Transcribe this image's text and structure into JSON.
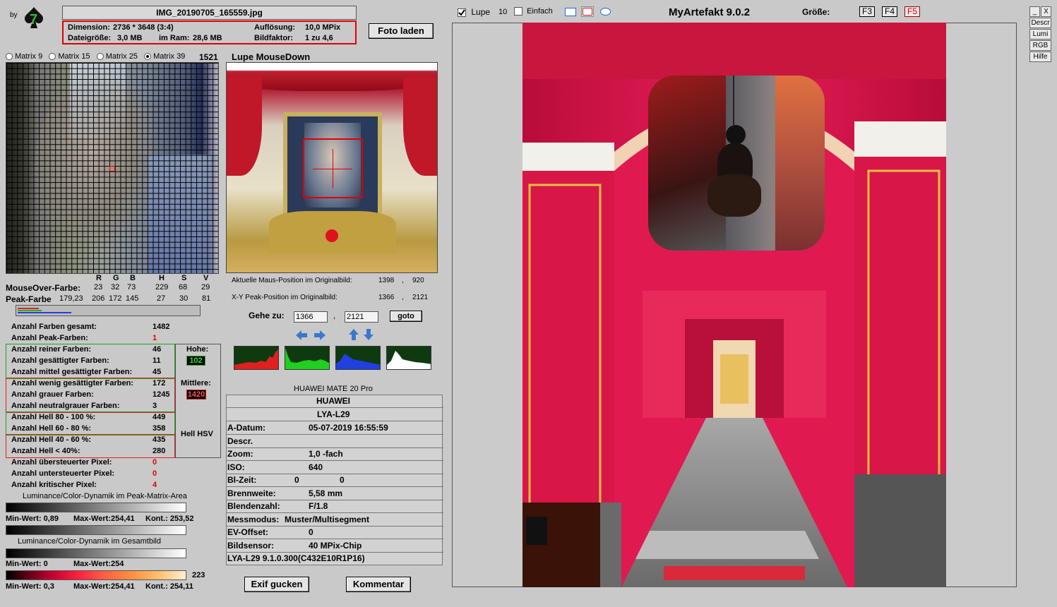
{
  "app": {
    "by_label": "by",
    "title": "MyArtefakt 9.0.2"
  },
  "file": {
    "name": "IMG_20190705_165559.jpg"
  },
  "info": {
    "dimension_label": "Dimension:",
    "dimension_value": "2736 * 3648 (3:4)",
    "aufloesung_label": "Auflösung:",
    "aufloesung_value": "10,0 MPix",
    "dateigroesse_label": "Dateigröße:",
    "dateigroesse_value": "3,0 MB",
    "imram_label": "im Ram:",
    "imram_value": "28,6 MB",
    "bildfaktor_label": "Bildfaktor:",
    "bildfaktor_value": "1 zu 4,6"
  },
  "buttons": {
    "foto_laden": "Foto laden",
    "exif": "Exif gucken",
    "kommentar": "Kommentar",
    "goto": "goto"
  },
  "toolbar": {
    "lupe_label": "Lupe",
    "lupe_checked": true,
    "lupe_value": "10",
    "einfach_label": "Einfach",
    "einfach_checked": false,
    "groesse_label": "Größe:",
    "keys": [
      "F3",
      "F4",
      "F5"
    ],
    "active_key": "F5"
  },
  "side": {
    "min": "_",
    "close": "X",
    "items": [
      "Descr",
      "Lumi",
      "RGB",
      "Hilfe"
    ]
  },
  "matrix": {
    "options": [
      "Matrix 9",
      "Matrix 15",
      "Matrix 25",
      "Matrix 39"
    ],
    "selected": 3,
    "count": "1521"
  },
  "lupe": {
    "title": "Lupe MouseDown"
  },
  "colors": {
    "headers": [
      "R",
      "G",
      "B",
      "H",
      "S",
      "V"
    ],
    "mouseover_label": "MouseOver-Farbe:",
    "mouseover": [
      "23",
      "32",
      "73",
      "229",
      "68",
      "29"
    ],
    "peak_label": "Peak-Farbe",
    "peak": [
      "179,23",
      "206",
      "172",
      "145",
      "27",
      "30",
      "81"
    ]
  },
  "positions": {
    "maus_label": "Aktuelle Maus-Position  im Originalbild:",
    "maus_x": "1398",
    "maus_y": "920",
    "peak_label": "X-Y Peak-Position  im Originalbild:",
    "peak_x": "1366",
    "peak_y": "2121",
    "sep": ","
  },
  "goto": {
    "label": "Gehe zu:",
    "x": "1366",
    "y": "2121",
    "sep": ","
  },
  "counts": [
    {
      "label": "Anzahl Farben gesamt:",
      "value": "1482",
      "color": "#000000"
    },
    {
      "label": "Anzahl Peak-Farben:",
      "value": "1",
      "color": "#e00000"
    },
    {
      "label": "Anzahl reiner Farben:",
      "value": "46",
      "color": "#000000"
    },
    {
      "label": "Anzahl gesättigter Farben:",
      "value": "11",
      "color": "#000000"
    },
    {
      "label": "Anzahl mittel gesättigter Farben:",
      "value": "45",
      "color": "#000000"
    },
    {
      "label": "Anzahl wenig gesättigter Farben:",
      "value": "172",
      "color": "#000000"
    },
    {
      "label": "Anzahl grauer Farben:",
      "value": "1245",
      "color": "#000000"
    },
    {
      "label": "Anzahl neutralgrauer Farben:",
      "value": "3",
      "color": "#000000"
    },
    {
      "label": "Anzahl Hell 80 - 100 %:",
      "value": "449",
      "color": "#000000"
    },
    {
      "label": "Anzahl Hell 60 - 80 %:",
      "value": "358",
      "color": "#000000"
    },
    {
      "label": "Anzahl Hell 40 - 60 %:",
      "value": "435",
      "color": "#000000"
    },
    {
      "label": "Anzahl Hell < 40%:",
      "value": "280",
      "color": "#000000"
    },
    {
      "label": "Anzahl übersteuerter Pixel:",
      "value": "0",
      "color": "#e00000"
    },
    {
      "label": "Anzahl untersteuerter Pixel:",
      "value": "0",
      "color": "#e00000"
    },
    {
      "label": "Anzahl kritischer Pixel:",
      "value": "4",
      "color": "#e00000"
    }
  ],
  "side_boxes": {
    "hohe_label": "Hohe:",
    "hohe_value": "102",
    "mittlere_label": "Mittlere:",
    "mittlere_value": "1420",
    "hell_label": "Hell HSV"
  },
  "dynamics": {
    "peak_title": "Luminance/Color-Dynamik im Peak-Matrix-Area",
    "peak_min": "Min-Wert: 0,89",
    "peak_max": "Max-Wert:254,41",
    "peak_kont": "Kont.: 253,52",
    "gesamt_title": "Luminance/Color-Dynamik im Gesamtbild",
    "gesamt_min": "Min-Wert: 0",
    "gesamt_max": "Max-Wert:254",
    "color_value": "223",
    "color_min": "Min-Wert: 0,3",
    "color_max": "Max-Wert:254,41",
    "color_kont": "Kont.: 254,11"
  },
  "exif": {
    "camera": "HUAWEI MATE 20 Pro",
    "make": "HUAWEI",
    "model": "LYA-L29",
    "rows": [
      {
        "label": "A-Datum:",
        "value": "05-07-2019 16:55:59"
      },
      {
        "label": "Descr.",
        "value": ""
      },
      {
        "label": "Zoom:",
        "value": "1,0 -fach"
      },
      {
        "label": "ISO:",
        "value": "640"
      },
      {
        "label": "Bl-Zeit:",
        "value": "0",
        "value2": "0"
      },
      {
        "label": "Brennweite:",
        "value": "5,58  mm"
      },
      {
        "label": "Blendenzahl:",
        "value": "F/1.8"
      },
      {
        "label": "Messmodus:",
        "value": "Muster/Multisegment"
      },
      {
        "label": "EV-Offset:",
        "value": "0"
      },
      {
        "label": "Bildsensor:",
        "value": "40 MPix-Chip"
      }
    ],
    "firmware": "LYA-L29 9.1.0.300(C432E10R1P16)"
  }
}
